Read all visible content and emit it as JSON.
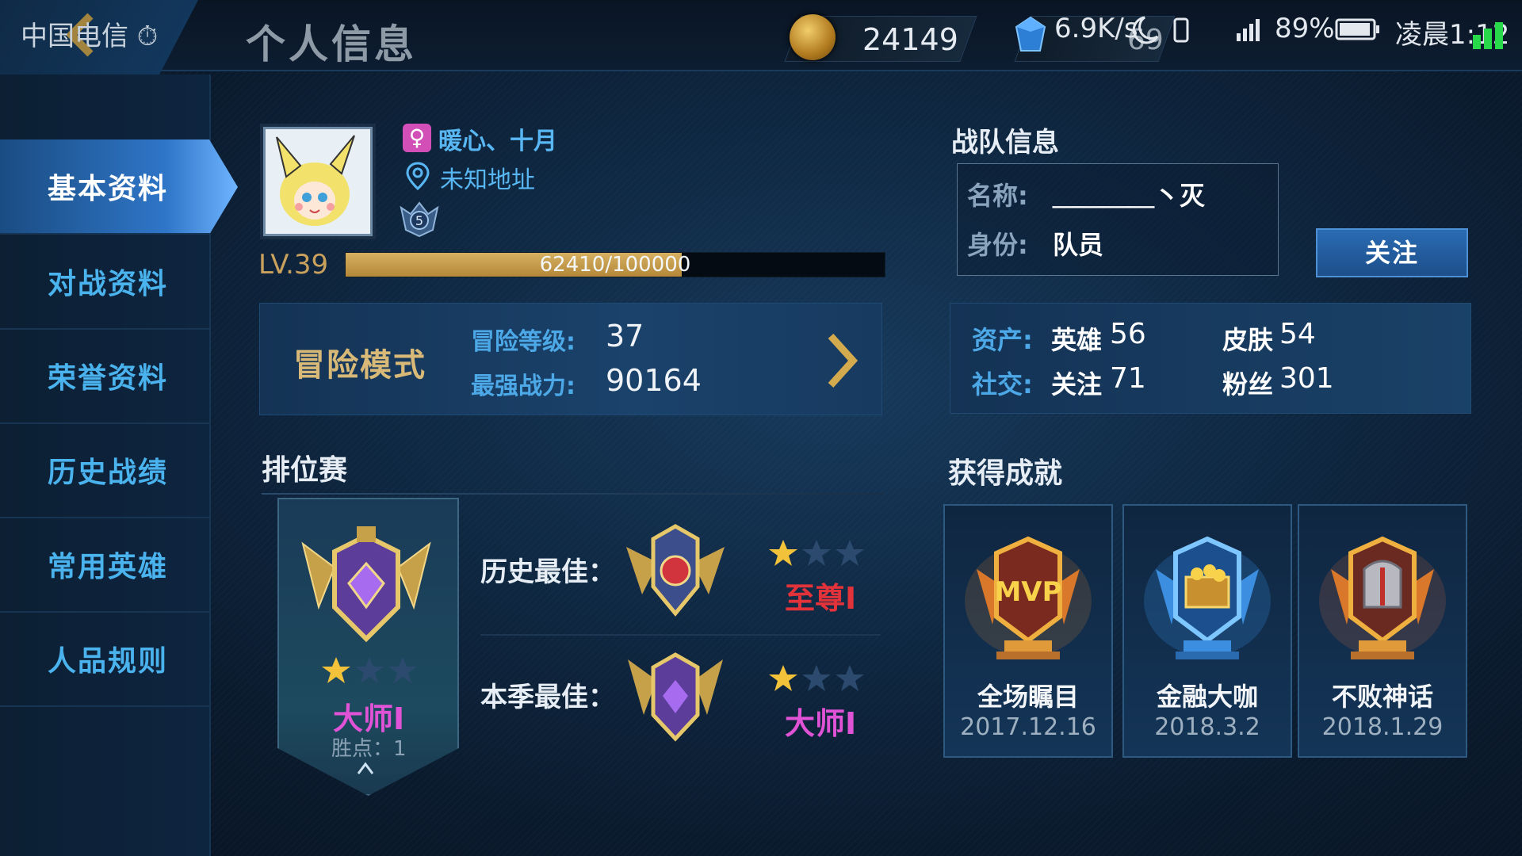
{
  "status_bar": {
    "carrier": "中国电信 ⏱",
    "net_speed": "6.9K/s",
    "battery": "89%",
    "time": "凌晨1:12"
  },
  "header": {
    "title": "个人信息",
    "gold": "24149",
    "gems": "69"
  },
  "sidebar": {
    "items": [
      {
        "label": "基本资料"
      },
      {
        "label": "对战资料"
      },
      {
        "label": "荣誉资料"
      },
      {
        "label": "历史战绩"
      },
      {
        "label": "常用英雄"
      },
      {
        "label": "人品规则"
      }
    ]
  },
  "profile": {
    "nickname": "暖心、十月",
    "location": "未知地址",
    "rank_level_badge": "5",
    "level": "LV.39",
    "xp_text": "62410/100000",
    "xp_current": 62410,
    "xp_max": 100000
  },
  "adventure": {
    "title": "冒险模式",
    "level_label": "冒险等级:",
    "level_value": "37",
    "power_label": "最强战力:",
    "power_value": "90164"
  },
  "team": {
    "heading": "战队信息",
    "name_label": "名称:",
    "name_value": "＿＿＿＿丶灭",
    "role_label": "身份:",
    "role_value": "队员",
    "follow_button": "关注"
  },
  "stats": {
    "assets_label": "资产:",
    "heroes_key": "英雄",
    "heroes_value": "56",
    "skins_key": "皮肤",
    "skins_value": "54",
    "social_label": "社交:",
    "following_key": "关注",
    "following_value": "71",
    "fans_key": "粉丝",
    "fans_value": "301"
  },
  "ranked": {
    "heading": "排位赛",
    "current_rank": "大师Ⅰ",
    "current_stars": 1,
    "win_points": "胜点：1",
    "history_best_label": "历史最佳：",
    "history_best_rank": "至尊Ⅰ",
    "history_best_stars": 1,
    "season_best_label": "本季最佳：",
    "season_best_rank": "大师Ⅰ",
    "season_best_stars": 1,
    "colors": {
      "supreme": "#e2323a",
      "master": "#e052d6"
    }
  },
  "achievements": {
    "heading": "获得成就",
    "items": [
      {
        "name": "全场瞩目",
        "date": "2017.12.16",
        "icon": "mvp-trophy-icon"
      },
      {
        "name": "金融大咖",
        "date": "2018.3.2",
        "icon": "treasure-trophy-icon"
      },
      {
        "name": "不败神话",
        "date": "2018.1.29",
        "icon": "helmet-trophy-icon"
      }
    ]
  }
}
